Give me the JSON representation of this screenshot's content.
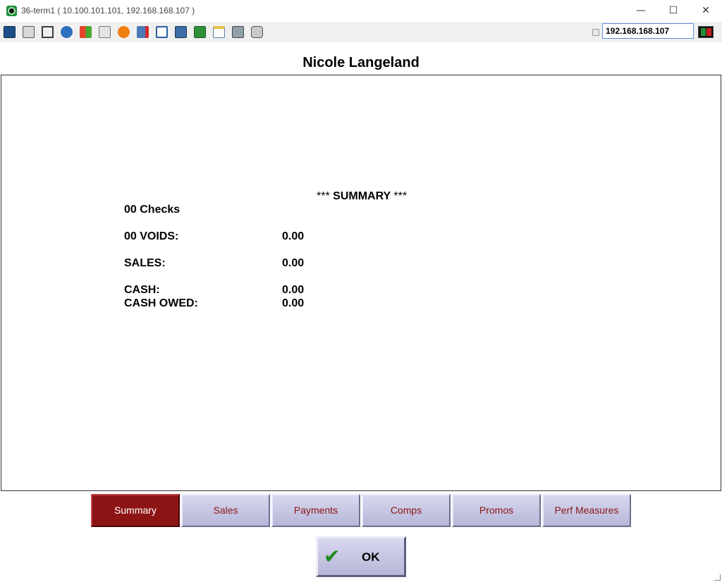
{
  "window": {
    "title": "36-term1 ( 10.100.101.101, 192.168.168.107 )",
    "minimize_glyph": "—",
    "maximize_glyph": "☐",
    "close_glyph": "✕"
  },
  "toolbar": {
    "icons": [
      "monitor-icon",
      "windows-icon",
      "tools-icon",
      "refresh-icon",
      "windows-logo-icon",
      "keyboard-icon",
      "alert-icon",
      "disconnect-icon",
      "fullscreen-icon",
      "display-icon",
      "download-icon",
      "notepad-icon",
      "screen-icon",
      "chat-icon"
    ],
    "ip_address": "192.168.168.107",
    "status_colors": [
      "#1f8f3a",
      "#c81e1e"
    ]
  },
  "header": {
    "name": "Nicole Langeland"
  },
  "report": {
    "title_stars_left": "***",
    "title": "SUMMARY",
    "title_stars_right": "***",
    "checks": "00 Checks",
    "voids_label": "00 VOIDS:",
    "voids_value": "0.00",
    "sales_label": "SALES:",
    "sales_value": "0.00",
    "cash_label": "CASH:",
    "cash_value": "0.00",
    "cash_owed_label": "CASH OWED:",
    "cash_owed_value": "0.00"
  },
  "tabs": [
    {
      "label": "Summary",
      "active": true
    },
    {
      "label": "Sales",
      "active": false
    },
    {
      "label": "Payments",
      "active": false
    },
    {
      "label": "Comps",
      "active": false
    },
    {
      "label": "Promos",
      "active": false
    },
    {
      "label": "Perf Measures",
      "active": false
    }
  ],
  "ok_button": {
    "label": "OK",
    "icon": "checkmark-icon",
    "check_glyph": "✔"
  },
  "colors": {
    "active_tab": "#8d1414",
    "tab_text": "#8b1515",
    "ok_check": "#1d8a1d"
  }
}
